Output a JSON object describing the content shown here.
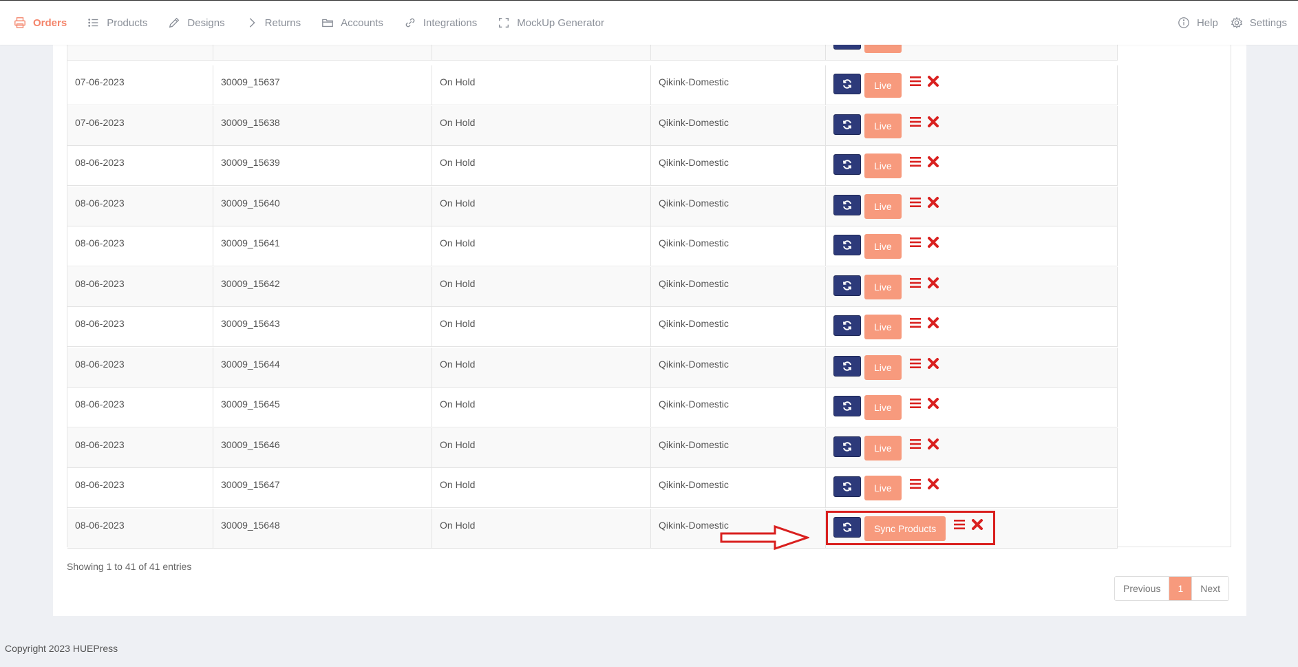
{
  "nav": {
    "left": [
      {
        "label": "Orders",
        "icon": "printer-icon",
        "active": true
      },
      {
        "label": "Products",
        "icon": "list-icon",
        "active": false
      },
      {
        "label": "Designs",
        "icon": "pencil-icon",
        "active": false
      },
      {
        "label": "Returns",
        "icon": "chevron-right-icon",
        "active": false
      },
      {
        "label": "Accounts",
        "icon": "folder-icon",
        "active": false
      },
      {
        "label": "Integrations",
        "icon": "link-icon",
        "active": false
      },
      {
        "label": "MockUp Generator",
        "icon": "expand-icon",
        "active": false
      }
    ],
    "right": [
      {
        "label": "Help",
        "icon": "info-icon"
      },
      {
        "label": "Settings",
        "icon": "gear-icon"
      }
    ]
  },
  "table": {
    "partial_row": {
      "live_label": "Live"
    },
    "rows": [
      {
        "date": "07-06-2023",
        "order_id": "30009_15637",
        "status": "On Hold",
        "shop": "Qikink-Domestic",
        "action_label": "Live"
      },
      {
        "date": "07-06-2023",
        "order_id": "30009_15638",
        "status": "On Hold",
        "shop": "Qikink-Domestic",
        "action_label": "Live"
      },
      {
        "date": "08-06-2023",
        "order_id": "30009_15639",
        "status": "On Hold",
        "shop": "Qikink-Domestic",
        "action_label": "Live"
      },
      {
        "date": "08-06-2023",
        "order_id": "30009_15640",
        "status": "On Hold",
        "shop": "Qikink-Domestic",
        "action_label": "Live"
      },
      {
        "date": "08-06-2023",
        "order_id": "30009_15641",
        "status": "On Hold",
        "shop": "Qikink-Domestic",
        "action_label": "Live"
      },
      {
        "date": "08-06-2023",
        "order_id": "30009_15642",
        "status": "On Hold",
        "shop": "Qikink-Domestic",
        "action_label": "Live"
      },
      {
        "date": "08-06-2023",
        "order_id": "30009_15643",
        "status": "On Hold",
        "shop": "Qikink-Domestic",
        "action_label": "Live"
      },
      {
        "date": "08-06-2023",
        "order_id": "30009_15644",
        "status": "On Hold",
        "shop": "Qikink-Domestic",
        "action_label": "Live"
      },
      {
        "date": "08-06-2023",
        "order_id": "30009_15645",
        "status": "On Hold",
        "shop": "Qikink-Domestic",
        "action_label": "Live"
      },
      {
        "date": "08-06-2023",
        "order_id": "30009_15646",
        "status": "On Hold",
        "shop": "Qikink-Domestic",
        "action_label": "Live"
      },
      {
        "date": "08-06-2023",
        "order_id": "30009_15647",
        "status": "On Hold",
        "shop": "Qikink-Domestic",
        "action_label": "Live"
      },
      {
        "date": "08-06-2023",
        "order_id": "30009_15648",
        "status": "On Hold",
        "shop": "Qikink-Domestic",
        "action_label": "Sync Products"
      }
    ]
  },
  "info": {
    "showing": "Showing 1 to 41 of 41 entries"
  },
  "pagination": {
    "previous": "Previous",
    "current": "1",
    "next": "Next"
  },
  "footer": {
    "copyright": "Copyright 2023 HUEPress"
  },
  "colors": {
    "accent": "#f79a7d",
    "sync_button": "#2d3a7a",
    "danger": "#d9201f",
    "active_nav": "#f4846a"
  }
}
